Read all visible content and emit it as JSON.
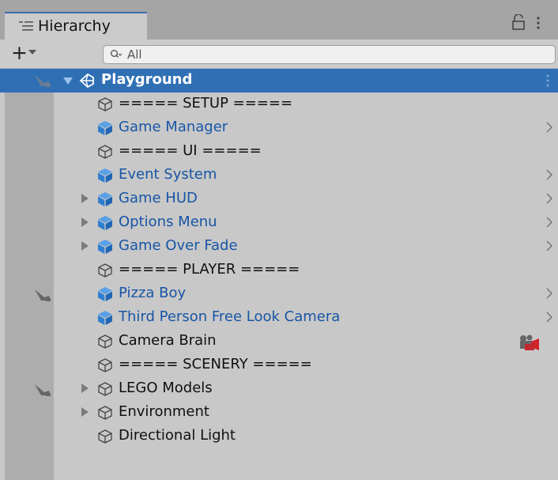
{
  "window": {
    "tab_label": "Hierarchy",
    "icons": {
      "tab": "hierarchy-list-icon",
      "lock": "lock-icon",
      "menu": "kebab-menu-icon"
    }
  },
  "toolbar": {
    "add_label": "+",
    "search_placeholder": "All",
    "icons": {
      "add": "plus-icon",
      "dropdown": "caret-down-icon",
      "search": "search-filter-icon"
    }
  },
  "hierarchy": {
    "scene": {
      "name": "Playground",
      "expanded": true,
      "selected": true,
      "icon": "unity-scene-icon"
    },
    "items": [
      {
        "name": "===== SETUP =====",
        "kind": "gameobject",
        "depth": 1,
        "expandable": false
      },
      {
        "name": "Game Manager",
        "kind": "prefab",
        "depth": 1,
        "expandable": false,
        "has_open_arrow": true
      },
      {
        "name": "===== UI =====",
        "kind": "gameobject",
        "depth": 1,
        "expandable": false
      },
      {
        "name": "Event System",
        "kind": "prefab",
        "depth": 1,
        "expandable": false,
        "has_open_arrow": true
      },
      {
        "name": "Game HUD",
        "kind": "prefab",
        "depth": 1,
        "expandable": true,
        "has_open_arrow": true
      },
      {
        "name": "Options Menu",
        "kind": "prefab",
        "depth": 1,
        "expandable": true,
        "has_open_arrow": true
      },
      {
        "name": "Game Over Fade",
        "kind": "prefab",
        "depth": 1,
        "expandable": true,
        "has_open_arrow": true
      },
      {
        "name": "===== PLAYER =====",
        "kind": "gameobject",
        "depth": 1,
        "expandable": false
      },
      {
        "name": "Pizza Boy",
        "kind": "prefab",
        "depth": 1,
        "expandable": false,
        "has_open_arrow": true,
        "visibility_hidden": true
      },
      {
        "name": "Third Person Free Look Camera",
        "kind": "prefab",
        "depth": 1,
        "expandable": false,
        "has_open_arrow": true
      },
      {
        "name": "Camera Brain",
        "kind": "gameobject",
        "depth": 1,
        "expandable": false,
        "trailing_icon": "camera-gizmo-icon"
      },
      {
        "name": "===== SCENERY =====",
        "kind": "gameobject",
        "depth": 1,
        "expandable": false
      },
      {
        "name": "LEGO Models",
        "kind": "gameobject",
        "depth": 1,
        "expandable": true,
        "visibility_hidden": true
      },
      {
        "name": "Environment",
        "kind": "gameobject",
        "depth": 1,
        "expandable": true
      },
      {
        "name": "Directional Light",
        "kind": "gameobject",
        "depth": 1,
        "expandable": false
      }
    ]
  },
  "colors": {
    "selection": "#2f70b5",
    "prefab_text": "#1755a6",
    "prefab_icon": "#2f7fd0",
    "panel_bg": "#c8c8c8",
    "tab_accent": "#3a72b0"
  }
}
